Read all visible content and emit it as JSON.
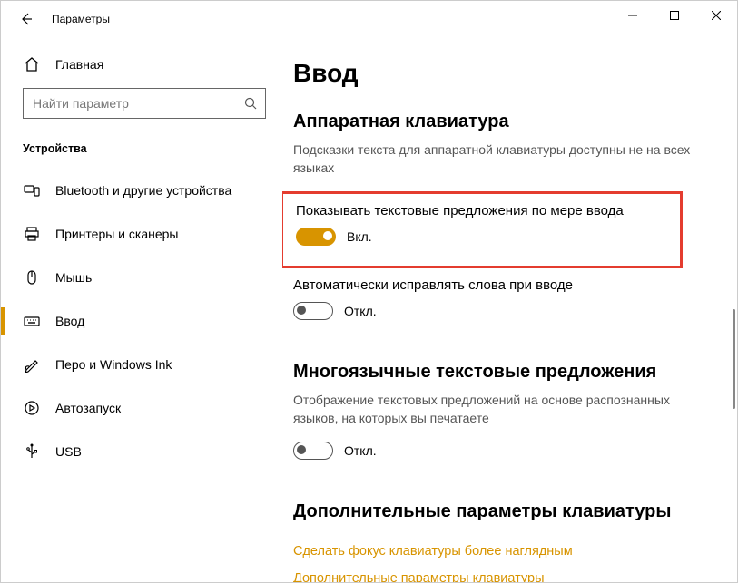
{
  "window": {
    "title": "Параметры"
  },
  "sidebar": {
    "home_label": "Главная",
    "search_placeholder": "Найти параметр",
    "category": "Устройства",
    "items": [
      {
        "label": "Bluetooth и другие устройства"
      },
      {
        "label": "Принтеры и сканеры"
      },
      {
        "label": "Мышь"
      },
      {
        "label": "Ввод"
      },
      {
        "label": "Перо и Windows Ink"
      },
      {
        "label": "Автозапуск"
      },
      {
        "label": "USB"
      }
    ]
  },
  "main": {
    "title": "Ввод",
    "hw_section_title": "Аппаратная клавиатура",
    "hw_section_sub": "Подсказки текста для аппаратной клавиатуры доступны не на всех языках",
    "suggestions_label": "Показывать текстовые предложения по мере ввода",
    "suggestions_state": "Вкл.",
    "autocorrect_label": "Автоматически исправлять слова при вводе",
    "autocorrect_state": "Откл.",
    "multi_section_title": "Многоязычные текстовые предложения",
    "multi_section_desc": "Отображение текстовых предложений на основе распознанных языков, на которых вы печатаете",
    "multi_state": "Откл.",
    "adv_section_title": "Дополнительные параметры клавиатуры",
    "link_focus": "Сделать фокус клавиатуры более наглядным",
    "link_adv": "Дополнительные параметры клавиатуры"
  }
}
